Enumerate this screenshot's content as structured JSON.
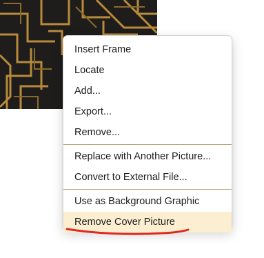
{
  "context_menu": {
    "items": [
      {
        "label": "Insert Frame"
      },
      {
        "label": "Locate"
      },
      {
        "label": "Add..."
      },
      {
        "label": "Export..."
      },
      {
        "label": "Remove..."
      },
      {
        "label": "Replace with Another Picture..."
      },
      {
        "label": "Convert to External File..."
      },
      {
        "label": "Use as Background Graphic"
      },
      {
        "label": "Remove Cover Picture",
        "highlighted": true
      }
    ]
  },
  "colors": {
    "highlight": "#fcefd1",
    "separator": "#b8a57a",
    "annotation": "#e0291f",
    "cover_gold": "#b88a3b",
    "cover_dark": "#1f1d1b"
  }
}
